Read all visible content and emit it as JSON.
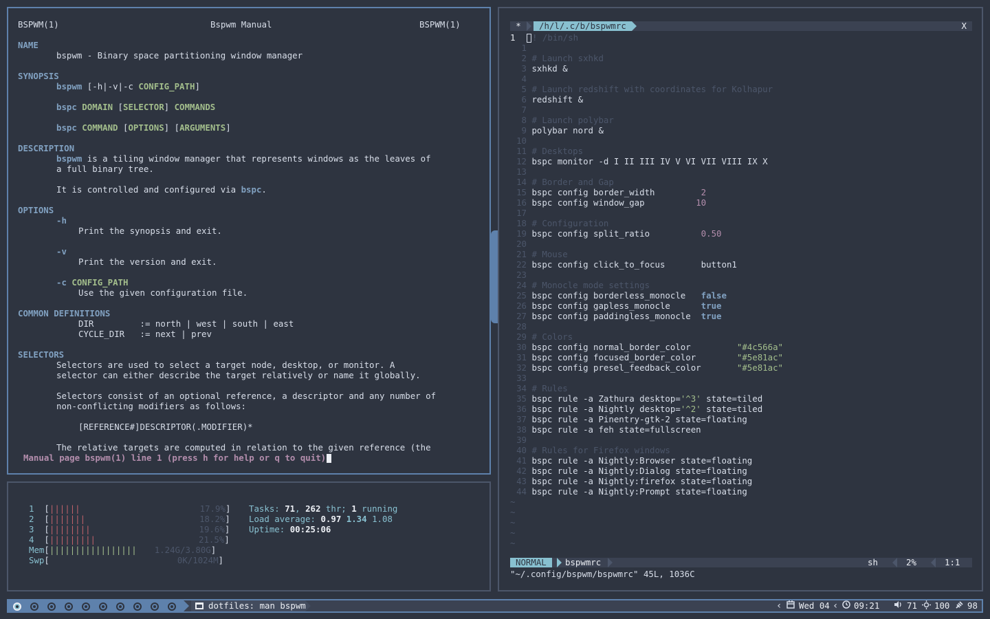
{
  "man": {
    "header_left": "BSPWM(1)",
    "header_center": "Bspwm Manual",
    "header_right": "BSPWM(1)",
    "name_heading": "NAME",
    "name_text": "bspwm - Binary space partitioning window manager",
    "synopsis_heading": "SYNOPSIS",
    "syn1_cmd": "bspwm",
    "syn1_flags": " [-h|-v|-c ",
    "syn1_arg": "CONFIG_PATH",
    "syn1_end": "]",
    "syn2_cmd": "bspc",
    "syn2_a": " DOMAIN",
    "syn2_b": " [",
    "syn2_c": "SELECTOR",
    "syn2_d": "] ",
    "syn2_e": "COMMANDS",
    "syn3_cmd": "bspc",
    "syn3_a": " COMMAND",
    "syn3_b": " [",
    "syn3_c": "OPTIONS",
    "syn3_d": "] [",
    "syn3_e": "ARGUMENTS",
    "syn3_f": "]",
    "description_heading": "DESCRIPTION",
    "desc1_cmd": "bspwm",
    "desc1_rest": " is a tiling window manager that represents windows as the leaves of",
    "desc2": "a full binary tree.",
    "desc3_a": "It is controlled and configured via ",
    "desc3_b": "bspc",
    "desc3_c": ".",
    "options_heading": "OPTIONS",
    "opt_h": "-h",
    "opt_h_desc": "Print the synopsis and exit.",
    "opt_v": "-v",
    "opt_v_desc": "Print the version and exit.",
    "opt_c": "-c",
    "opt_c_arg": "CONFIG_PATH",
    "opt_c_desc": "Use the given configuration file.",
    "common_heading": "COMMON DEFINITIONS",
    "def1": "DIR         := north | west | south | east",
    "def2": "CYCLE_DIR   := next | prev",
    "selectors_heading": "SELECTORS",
    "sel1": "Selectors are used to select a target node, desktop, or monitor. A",
    "sel2": "selector can either describe the target relatively or name it globally.",
    "sel3": "Selectors consist of an optional reference, a descriptor and any number of",
    "sel4": "non-conflicting modifiers as follows:",
    "sel5": "[REFERENCE#]DESCRIPTOR(.MODIFIER)*",
    "sel6": "The relative targets are computed in relation to the given reference (the",
    "prompt": "Manual page bspwm(1) line 1 (press h for help or q to quit)"
  },
  "htop": {
    "cpus": [
      {
        "num": "1",
        "bars": "||||||",
        "pct": "17.9%"
      },
      {
        "num": "2",
        "bars": "|||||||",
        "pct": "18.2%"
      },
      {
        "num": "3",
        "bars": "||||||||",
        "pct": "19.6%"
      },
      {
        "num": "4",
        "bars": "|||||||||",
        "pct": "21.5%"
      }
    ],
    "mem_label": "Mem",
    "mem_bars": "|||||||||||||||||",
    "mem_value": "1.24G/3.80G",
    "swp_label": "Swp",
    "swp_value": "0K/1024M",
    "tasks_label": "Tasks: ",
    "tasks_count": "71",
    "tasks_sep": ", ",
    "threads": "262",
    "threads_label": " thr; ",
    "running": "1",
    "running_label": " running",
    "load_label": "Load average: ",
    "load1": "0.97",
    "load5": "1.34",
    "load15": "1.08",
    "uptime_label": "Uptime: ",
    "uptime": "00:25:06"
  },
  "vim": {
    "tab_star": "*",
    "tab_file": "/h/l/.c/b/bspwmrc",
    "tab_close": "X",
    "lines": [
      {
        "n": "1",
        "cur": true,
        "t": "! /bin/sh"
      },
      {
        "n": "1",
        "t": ""
      },
      {
        "n": "2",
        "t": "# Launch sxhkd",
        "c": true
      },
      {
        "n": "3",
        "t": "sxhkd &"
      },
      {
        "n": "4",
        "t": ""
      },
      {
        "n": "5",
        "t": "# Launch redshift with coordinates for Kolhapur",
        "c": true
      },
      {
        "n": "6",
        "t": "redshift &"
      },
      {
        "n": "7",
        "t": ""
      },
      {
        "n": "8",
        "t": "# Launch polybar",
        "c": true
      },
      {
        "n": "9",
        "t": "polybar nord &"
      },
      {
        "n": "10",
        "t": ""
      },
      {
        "n": "11",
        "t": "# Desktops",
        "c": true
      },
      {
        "n": "12",
        "t": "bspc monitor -d I II III IV V VI VII VIII IX X"
      },
      {
        "n": "13",
        "t": ""
      },
      {
        "n": "14",
        "t": "# Border and Gap",
        "c": true
      },
      {
        "n": "15",
        "t": "bspc config border_width         ",
        "v": "2",
        "vc": "num"
      },
      {
        "n": "16",
        "t": "bspc config window_gap          ",
        "v": "10",
        "vc": "num"
      },
      {
        "n": "17",
        "t": ""
      },
      {
        "n": "18",
        "t": "# Configuration",
        "c": true
      },
      {
        "n": "19",
        "t": "bspc config split_ratio          ",
        "v": "0.50",
        "vc": "num"
      },
      {
        "n": "20",
        "t": ""
      },
      {
        "n": "21",
        "t": "# Mouse",
        "c": true
      },
      {
        "n": "22",
        "t": "bspc config click_to_focus       button1"
      },
      {
        "n": "23",
        "t": ""
      },
      {
        "n": "24",
        "t": "# Monocle mode settings",
        "c": true
      },
      {
        "n": "25",
        "t": "bspc config borderless_monocle   ",
        "v": "false",
        "vc": "bool"
      },
      {
        "n": "26",
        "t": "bspc config gapless_monocle      ",
        "v": "true",
        "vc": "bool"
      },
      {
        "n": "27",
        "t": "bspc config paddingless_monocle  ",
        "v": "true",
        "vc": "bool"
      },
      {
        "n": "28",
        "t": ""
      },
      {
        "n": "29",
        "t": "# Colors",
        "c": true
      },
      {
        "n": "30",
        "t": "bspc config normal_border_color         ",
        "v": "\"#4c566a\"",
        "vc": "str"
      },
      {
        "n": "31",
        "t": "bspc config focused_border_color        ",
        "v": "\"#5e81ac\"",
        "vc": "str"
      },
      {
        "n": "32",
        "t": "bspc config presel_feedback_color       ",
        "v": "\"#5e81ac\"",
        "vc": "str"
      },
      {
        "n": "33",
        "t": ""
      },
      {
        "n": "34",
        "t": "# Rules",
        "c": true
      },
      {
        "n": "35",
        "t": "bspc rule -a Zathura desktop=",
        "v": "'^3'",
        "vc": "str",
        "t2": " state=tiled"
      },
      {
        "n": "36",
        "t": "bspc rule -a Nightly desktop=",
        "v": "'^2'",
        "vc": "str",
        "t2": " state=tiled"
      },
      {
        "n": "37",
        "t": "bspc rule -a Pinentry-gtk-2 state=floating"
      },
      {
        "n": "38",
        "t": "bspc rule -a feh state=fullscreen"
      },
      {
        "n": "39",
        "t": ""
      },
      {
        "n": "40",
        "t": "# Rules for Firefox windows",
        "c": true
      },
      {
        "n": "41",
        "t": "bspc rule -a Nightly:Browser state=floating"
      },
      {
        "n": "42",
        "t": "bspc rule -a Nightly:Dialog state=floating"
      },
      {
        "n": "43",
        "t": "bspc rule -a Nightly:firefox state=floating"
      },
      {
        "n": "44",
        "t": "bspc rule -a Nightly:Prompt state=floating"
      }
    ],
    "tildes": [
      "~",
      "~",
      "~",
      "~",
      "~"
    ],
    "mode": "NORMAL",
    "status_file": "bspwmrc",
    "filetype": "sh",
    "percent": "2%",
    "position": "1:1",
    "cmdline": "\"~/.config/bspwm/bspwmrc\" 45L, 1036C"
  },
  "bar": {
    "workspace_count": 10,
    "window_title": "dotfiles: man bspwm",
    "date": "Wed 04",
    "time": "09:21",
    "volume": "71",
    "brightness": "100",
    "battery": "98",
    "colors": {
      "bg": "#3b4252",
      "accent": "#5e81ac",
      "highlight": "#88c0d0"
    }
  }
}
